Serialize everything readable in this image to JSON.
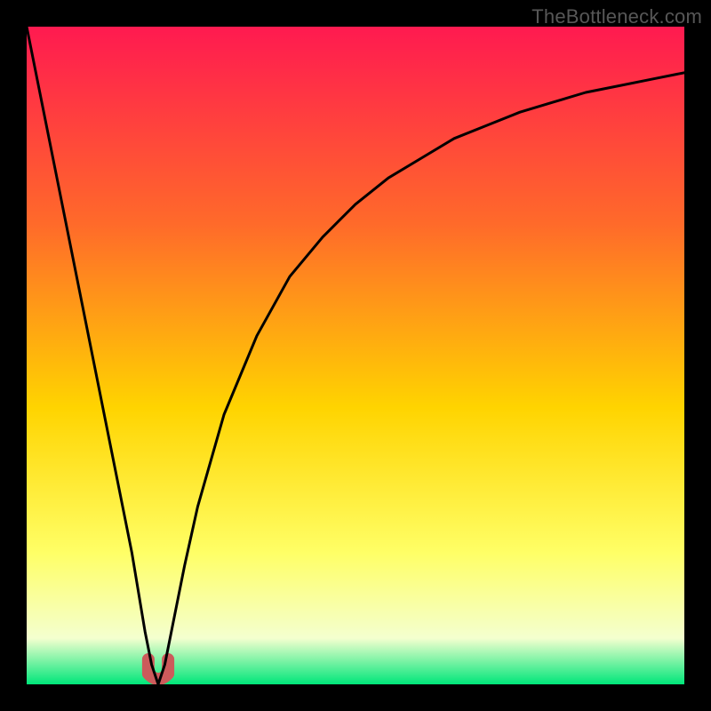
{
  "attribution": "TheBottleneck.com",
  "colors": {
    "top": "#ff1a50",
    "mid_upper": "#ff6a2a",
    "mid": "#ffd400",
    "mid_lower": "#ffff66",
    "pale": "#f4ffcf",
    "bottom": "#00e67a",
    "stroke": "#000000",
    "marker": "#cc5b5b",
    "frame": "#000000"
  },
  "chart_data": {
    "type": "line",
    "title": "",
    "xlabel": "",
    "ylabel": "",
    "xlim": [
      0,
      100
    ],
    "ylim": [
      0,
      100
    ],
    "series": [
      {
        "name": "curve",
        "x": [
          0,
          2,
          4,
          6,
          8,
          10,
          12,
          14,
          16,
          18,
          19,
          20,
          21,
          22,
          24,
          26,
          30,
          35,
          40,
          45,
          50,
          55,
          60,
          65,
          70,
          75,
          80,
          85,
          90,
          95,
          100
        ],
        "values": [
          100,
          90,
          80,
          70,
          60,
          50,
          40,
          30,
          20,
          8,
          3,
          0,
          3,
          8,
          18,
          27,
          41,
          53,
          62,
          68,
          73,
          77,
          80,
          83,
          85,
          87,
          88.5,
          90,
          91,
          92,
          93
        ]
      }
    ],
    "marker": {
      "x": 20,
      "y": 0,
      "approx_width_pct": 3
    },
    "notes": "Axes are unlabeled; values estimated from pixel geometry on a 0–100 normalized scale."
  }
}
